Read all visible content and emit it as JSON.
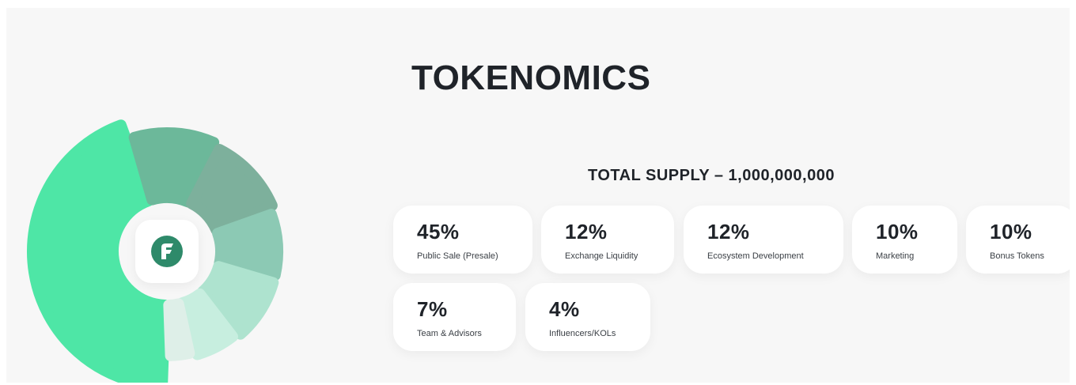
{
  "title": "TOKENOMICS",
  "total_supply": "TOTAL SUPPLY – 1,000,000,000",
  "colors": {
    "primary": "#4ee6a6",
    "brand_icon": "#2e8a6a",
    "segments": [
      "#4ee6a6",
      "#6cb89a",
      "#7db09c",
      "#8cc9b4",
      "#aee3cf",
      "#c7eedf",
      "#deefe8"
    ]
  },
  "chart_data": {
    "type": "pie",
    "style": "donut",
    "categories": [
      "Public Sale (Presale)",
      "Exchange Liquidity",
      "Ecosystem Development",
      "Marketing",
      "Bonus Tokens",
      "Team & Advisors",
      "Influencers/KOLs"
    ],
    "values": [
      45,
      12,
      12,
      10,
      10,
      7,
      4
    ],
    "labels": [
      "45%",
      "12%",
      "12%",
      "10%",
      "10%",
      "7%",
      "4%"
    ]
  },
  "logo": {
    "icon": "brand-f-logo-icon"
  }
}
